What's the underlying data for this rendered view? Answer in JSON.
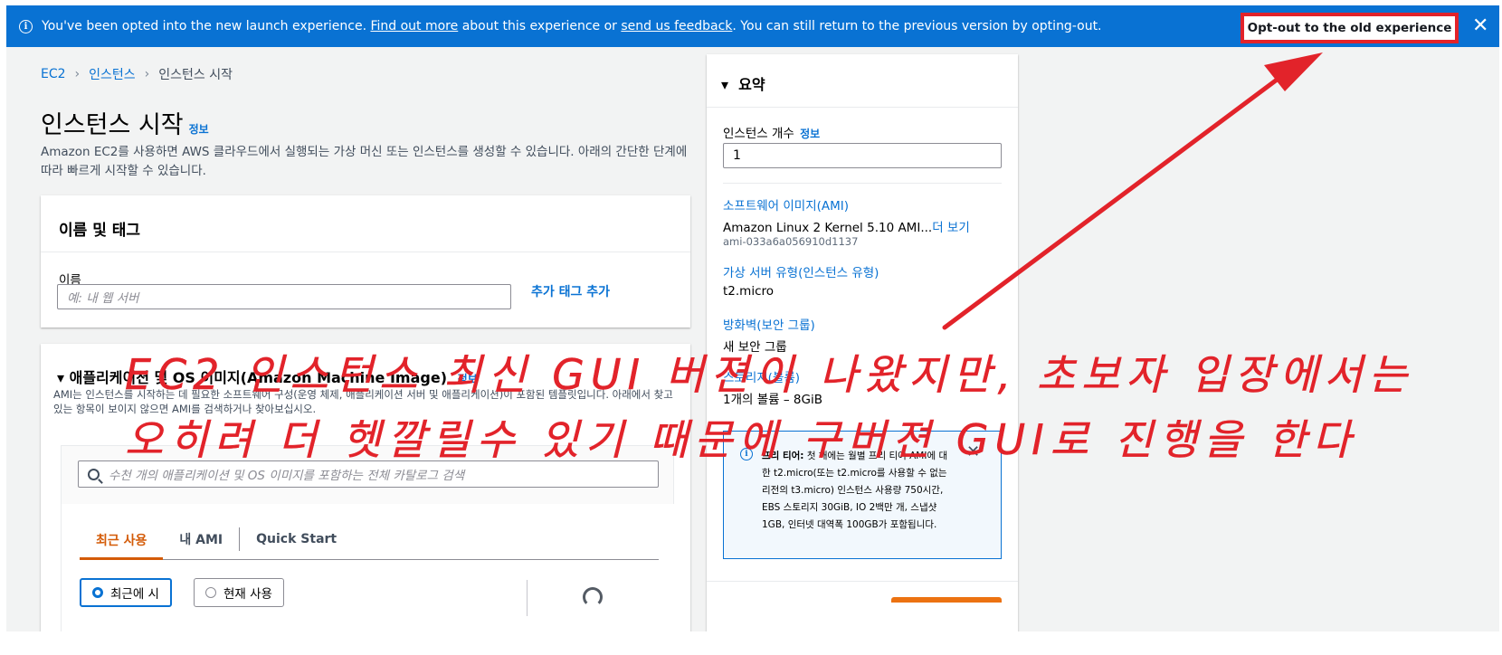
{
  "banner": {
    "text_before": "You've been opted into the new launch experience. ",
    "link_find_out": "Find out more",
    "text_middle": " about this experience or ",
    "link_feedback": "send us feedback",
    "text_after": ". You can still return to the previous version by opting-out.",
    "optout_label": "Opt-out to the old experience",
    "close_glyph": "✕"
  },
  "breadcrumb": [
    "EC2",
    "인스턴스",
    "인스턴스 시작"
  ],
  "page": {
    "title": "인스턴스 시작",
    "info": "정보",
    "description": "Amazon EC2를 사용하면 AWS 클라우드에서 실행되는 가상 머신 또는 인스턴스를 생성할 수 있습니다. 아래의 간단한 단계에 따라 빠르게 시작할 수 있습니다."
  },
  "name_panel": {
    "heading": "이름 및 태그",
    "name_label": "이름",
    "name_placeholder": "예: 내 웹 서버",
    "add_tag": "추가 태그 추가"
  },
  "ami_panel": {
    "heading": "애플리케이션 및 OS 이미지(Amazon Machine Image)",
    "info": "정보",
    "description": "AMI는 인스턴스를 시작하는 데 필요한 소프트웨어 구성(운영 체제, 애플리케이션 서버 및 애플리케이션)이 포함된 템플릿입니다. 아래에서 찾고 있는 항목이 보이지 않으면 AMI를 검색하거나 찾아보십시오.",
    "search_placeholder": "수천 개의 애플리케이션 및 OS 이미지를 포함하는 전체 카탈로그 검색",
    "tabs": [
      "최근 사용",
      "내 AMI",
      "Quick Start"
    ],
    "radio_recent": "최근에 시",
    "radio_current": "현재 사용"
  },
  "summary": {
    "heading": "요약",
    "instance_count_label": "인스턴스 개수",
    "instance_count_info": "정보",
    "instance_count_value": "1",
    "ami_label": "소프트웨어 이미지(AMI)",
    "ami_name": "Amazon Linux 2 Kernel 5.10 AMI...",
    "ami_more": "더 보기",
    "ami_id": "ami-033a6a056910d1137",
    "type_label": "가상 서버 유형(인스턴스 유형)",
    "type_value": "t2.micro",
    "firewall_label": "방화벽(보안 그룹)",
    "firewall_value": "새 보안 그룹",
    "storage_label": "스토리지(볼륨)",
    "storage_value": "1개의 볼륨 – 8GiB",
    "free_tier_title": "프리 티어:",
    "free_tier_text": " 첫 해에는 월별 프리 티어 AMI에 대한 t2.micro(또는 t2.micro를 사용할 수 없는 리전의 t3.micro) 인스턴스 사용량 750시간, EBS 스토리지 30GiB, IO 2백만 개, 스냅샷 1GB, 인터넷 대역폭 100GB가 포함됩니다.",
    "free_tier_close": "✕"
  },
  "annotation": {
    "line1": "EC2 인스턴스 최신 GUI 버젼이 나왔지만, 초보자 입장에서는",
    "line2": "오히려 더 헷깔릴수 있기 때문에 구버젼 GUI로 진행을 한다",
    "color": "#e2232a"
  },
  "colors": {
    "banner": "#0972d3",
    "link": "#0972d3",
    "active_tab": "#d45b07",
    "launch_button": "#ec7211"
  }
}
